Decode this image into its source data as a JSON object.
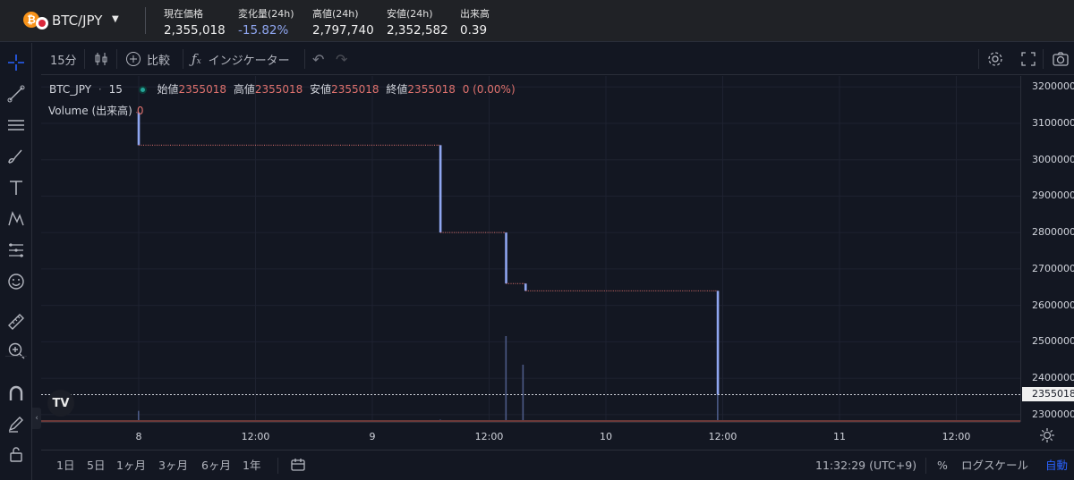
{
  "ticker": {
    "pair": "BTC/JPY",
    "coin_icon": "₿",
    "stats": [
      {
        "label": "現在価格",
        "value": "2,355,018",
        "negative": false
      },
      {
        "label": "変化量(24h)",
        "value": "-15.82%",
        "negative": true
      },
      {
        "label": "高値(24h)",
        "value": "2,797,740",
        "negative": false
      },
      {
        "label": "安値(24h)",
        "value": "2,352,582",
        "negative": false
      },
      {
        "label": "出来高",
        "value": "0.39",
        "negative": false
      }
    ]
  },
  "toolbar": {
    "interval": "15分",
    "compare": "比較",
    "indicators": "インジケーター"
  },
  "legend": {
    "symbol": "BTC_JPY",
    "sep": "·",
    "interval": "15",
    "open_label": "始値",
    "open": "2355018",
    "high_label": "高値",
    "high": "2355018",
    "low_label": "安値",
    "low": "2355018",
    "close_label": "終値",
    "close": "2355018",
    "change": "0 (0.00%)"
  },
  "volume_legend": {
    "label": "Volume (出来高)",
    "value": "0"
  },
  "tv_logo": "TV",
  "price_axis": {
    "ticks": [
      "3200000",
      "3100000",
      "3000000",
      "2900000",
      "2800000",
      "2700000",
      "2600000",
      "2500000",
      "2400000",
      "2300000"
    ],
    "last_price_label": "2355018"
  },
  "time_axis": {
    "ticks": [
      "8",
      "12:00",
      "9",
      "12:00",
      "10",
      "12:00",
      "11",
      "12:00"
    ]
  },
  "bottom": {
    "ranges": [
      "1日",
      "5日",
      "1ヶ月",
      "3ヶ月",
      "6ヶ月",
      "1年"
    ],
    "time": "11:32:29 (UTC+9)",
    "percent": "%",
    "log": "ログスケール",
    "auto": "自動"
  },
  "colors": {
    "background": "#131722",
    "up": "#8fa6f0",
    "down": "#e0726e",
    "grid": "#1e2230",
    "accent": "#2962ff"
  },
  "chart_data": {
    "type": "line",
    "title": "",
    "xlabel": "",
    "ylabel": "",
    "ylim": [
      2280000,
      3230000
    ],
    "x_tick_labels": [
      "8",
      "12:00",
      "9",
      "12:00",
      "10",
      "12:00",
      "11",
      "12:00"
    ],
    "y_tick_labels": [
      3200000,
      3100000,
      3000000,
      2900000,
      2800000,
      2700000,
      2600000,
      2500000,
      2400000,
      2300000
    ],
    "series": [
      {
        "points": [
          {
            "t": "7 23:45",
            "price": 3130000
          },
          {
            "t": "8 00:00",
            "price": 3040000
          },
          {
            "t": "9 06:45",
            "price": 3040000
          },
          {
            "t": "9 07:00",
            "price": 2800000
          },
          {
            "t": "9 13:30",
            "price": 2800000
          },
          {
            "t": "9 13:45",
            "price": 2660000
          },
          {
            "t": "9 15:30",
            "price": 2660000
          },
          {
            "t": "9 15:45",
            "price": 2640000
          },
          {
            "t": "10 11:15",
            "price": 2640000
          },
          {
            "t": "10 11:30",
            "price": 2355018
          }
        ]
      }
    ],
    "volume_bars": [
      {
        "t": "8 00:00",
        "v": 0.05
      },
      {
        "t": "9 07:00",
        "v": 0.01
      },
      {
        "t": "9 13:45",
        "v": 0.39
      },
      {
        "t": "9 15:30",
        "v": 0.26
      },
      {
        "t": "10 11:30",
        "v": 0.23
      }
    ],
    "last_price": 2355018,
    "grid": true
  }
}
